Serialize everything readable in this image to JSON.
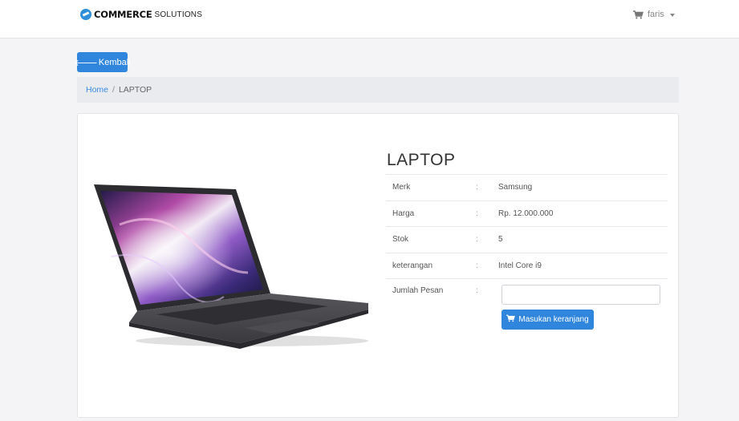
{
  "navbar": {
    "brand_strong": "COMMERCE",
    "brand_light": "SOLUTIONS",
    "username": "faris"
  },
  "back_button": {
    "arrow": "🡐",
    "label": "Kembali"
  },
  "breadcrumb": {
    "home": "Home",
    "separator": "/",
    "current": "LAPTOP"
  },
  "product": {
    "title": "LAPTOP",
    "image_alt": "laptop",
    "specs": [
      {
        "label": "Merk",
        "colon": ":",
        "value": "Samsung"
      },
      {
        "label": "Harga",
        "colon": ":",
        "value": "Rp. 12.000.000"
      },
      {
        "label": "Stok",
        "colon": ":",
        "value": "5"
      },
      {
        "label": "keterangan",
        "colon": ":",
        "value": "Intel Core i9"
      }
    ],
    "order": {
      "label": "Jumlah Pesan",
      "colon": ":",
      "quantity_value": "",
      "quantity_placeholder": "",
      "button_label": "Masukan keranjang"
    }
  },
  "colors": {
    "primary": "#2f86dc",
    "link": "#3a8be0",
    "breadcrumb_bg": "#e9ebee",
    "page_bg": "#f4f4f6"
  },
  "icons": {
    "brand": "brand-logo-icon",
    "cart": "shopping-cart-icon",
    "caret": "caret-down-icon",
    "back": "arrow-left-icon"
  }
}
